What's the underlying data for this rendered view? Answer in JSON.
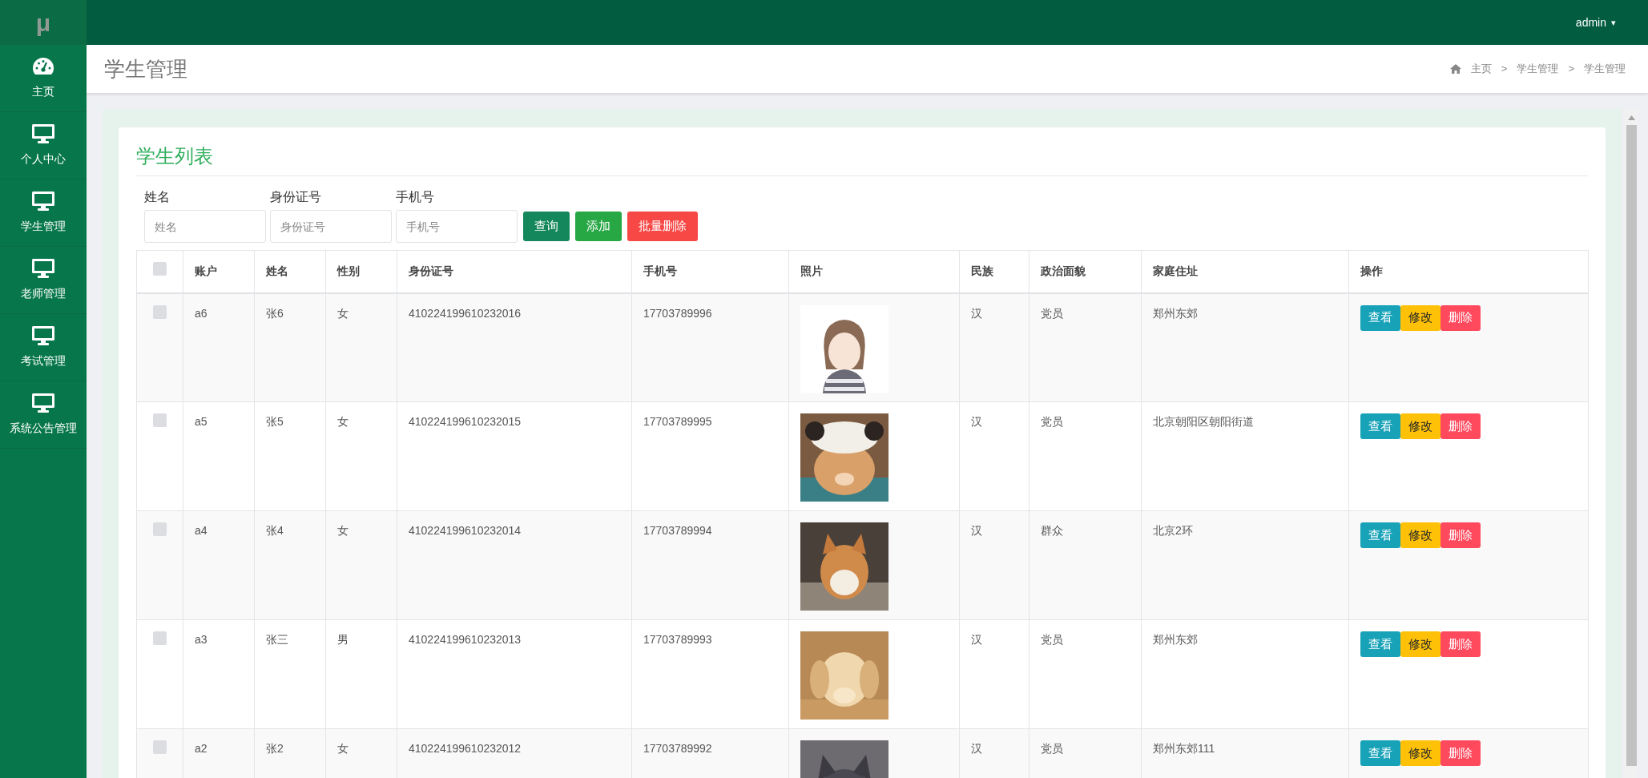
{
  "logo": "μ",
  "user_menu": {
    "label": "admin",
    "caret": "▾"
  },
  "sidebar": {
    "items": [
      {
        "label": "主页"
      },
      {
        "label": "个人中心"
      },
      {
        "label": "学生管理"
      },
      {
        "label": "老师管理"
      },
      {
        "label": "考试管理"
      },
      {
        "label": "系统公告管理"
      }
    ]
  },
  "page_title": "学生管理",
  "breadcrumb": [
    {
      "label": "主页"
    },
    {
      "label": "学生管理"
    },
    {
      "label": "学生管理"
    }
  ],
  "breadcrumb_separator": ">",
  "card_title": "学生列表",
  "filters": [
    {
      "label": "姓名",
      "placeholder": "姓名"
    },
    {
      "label": "身份证号",
      "placeholder": "身份证号"
    },
    {
      "label": "手机号",
      "placeholder": "手机号"
    }
  ],
  "filter_buttons": [
    {
      "label": "查询",
      "kind": "query"
    },
    {
      "label": "添加",
      "kind": "add"
    },
    {
      "label": "批量删除",
      "kind": "batch-delete"
    }
  ],
  "table": {
    "select_all": {
      "checked": false
    },
    "columns": [
      "账户",
      "姓名",
      "性别",
      "身份证号",
      "手机号",
      "照片",
      "民族",
      "政治面貌",
      "家庭住址",
      "操作"
    ],
    "rows": [
      {
        "checked": false,
        "cells": [
          "a6",
          "张6",
          "女",
          "410224199610232016",
          "17703789996",
          {
            "kind": "picture"
          },
          "汉",
          "党员",
          "郑州东郊",
          [
            {
              "label": "查看",
              "kind": "view"
            },
            {
              "label": "修改",
              "kind": "edit"
            },
            {
              "label": "删除",
              "kind": "delete"
            }
          ]
        ]
      },
      {
        "checked": false,
        "cells": [
          "a5",
          "张5",
          "女",
          "410224199610232015",
          "17703789995",
          {
            "kind": "picture"
          },
          "汉",
          "党员",
          "北京朝阳区朝阳街道",
          [
            {
              "label": "查看",
              "kind": "view"
            },
            {
              "label": "修改",
              "kind": "edit"
            },
            {
              "label": "删除",
              "kind": "delete"
            }
          ]
        ]
      },
      {
        "checked": false,
        "cells": [
          "a4",
          "张4",
          "女",
          "410224199610232014",
          "17703789994",
          {
            "kind": "picture"
          },
          "汉",
          "群众",
          "北京2环",
          [
            {
              "label": "查看",
              "kind": "view"
            },
            {
              "label": "修改",
              "kind": "edit"
            },
            {
              "label": "删除",
              "kind": "delete"
            }
          ]
        ]
      },
      {
        "checked": false,
        "cells": [
          "a3",
          "张三",
          "男",
          "410224199610232013",
          "17703789993",
          {
            "kind": "picture"
          },
          "汉",
          "党员",
          "郑州东郊",
          [
            {
              "label": "查看",
              "kind": "view"
            },
            {
              "label": "修改",
              "kind": "edit"
            },
            {
              "label": "删除",
              "kind": "delete"
            }
          ]
        ]
      },
      {
        "checked": false,
        "cells": [
          "a2",
          "张2",
          "女",
          "410224199610232012",
          "17703789992",
          {
            "kind": "picture"
          },
          "汉",
          "党员",
          "郑州东郊111",
          [
            {
              "label": "查看",
              "kind": "view"
            },
            {
              "label": "修改",
              "kind": "edit"
            },
            {
              "label": "删除",
              "kind": "delete"
            }
          ]
        ]
      }
    ]
  }
}
